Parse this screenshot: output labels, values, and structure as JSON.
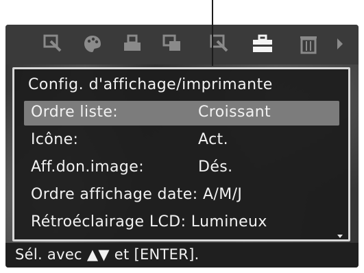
{
  "toolbar": {
    "icons": [
      "zoom-select-icon",
      "palette-icon",
      "print-icon",
      "copy-icon",
      "zoom-select-icon",
      "toolbox-icon",
      "trash-icon",
      "arrow-right-icon"
    ],
    "active_icon": "toolbox-icon"
  },
  "menu": {
    "title": "Config. d'affichage/imprimante",
    "items": [
      {
        "label": "Ordre liste:",
        "value": "Croissant",
        "selected": true
      },
      {
        "label": "Icône:",
        "value": "Act."
      },
      {
        "label": "Aff.don.image:",
        "value": "Dés."
      },
      {
        "text": "Ordre affichage date: A/M/J"
      },
      {
        "text": "Rétroéclairage LCD: Lumineux"
      }
    ]
  },
  "help": {
    "text": "Sél. avec ▲▼ et [ENTER]."
  },
  "colors": {
    "screen_bg": "#2b2b2b",
    "panel_border": "#d8d8d8",
    "selected_row": "#7c7c7c",
    "text": "#f2f2f2"
  }
}
